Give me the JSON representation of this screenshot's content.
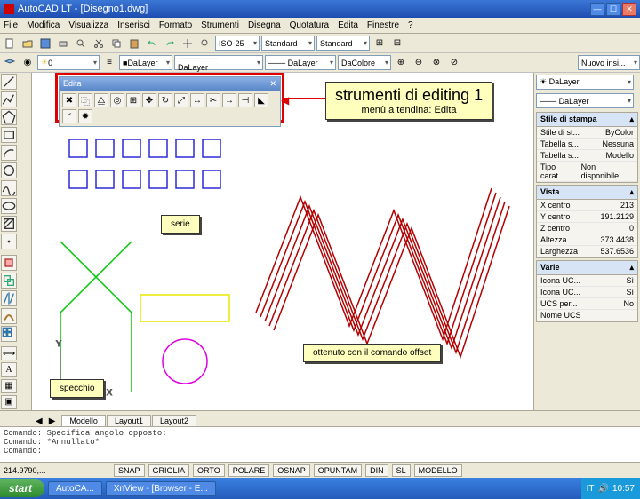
{
  "window": {
    "title": "AutoCAD LT - [Disegno1.dwg]",
    "close": "✕",
    "min": "—",
    "max": "☐"
  },
  "menus": [
    "File",
    "Modifica",
    "Visualizza",
    "Inserisci",
    "Formato",
    "Strumenti",
    "Disegna",
    "Quotatura",
    "Edita",
    "Finestre",
    "?"
  ],
  "selectors": {
    "layer": "0",
    "color": "DaLayer",
    "ltype": "─────── DaLayer",
    "lweight": "─── DaLayer",
    "scale": "ISO-25",
    "style": "Standard",
    "standard": "Standard",
    "altro": "DaColore",
    "nuovo": "Nuovo insi..."
  },
  "floatbar": {
    "title": "Edita",
    "close": "✕"
  },
  "annotations": {
    "title": "strumenti di editing 1",
    "subtitle": "menù a tendina: Edita",
    "serie": "serie",
    "specchio": "specchio",
    "offset": "ottenuto con il comando offset"
  },
  "rpanel": {
    "stile_hdr": "Stile di stampa",
    "stile_rows": [
      [
        "Stile di st...",
        "ByColor"
      ],
      [
        "Tabella s...",
        "Nessuna"
      ],
      [
        "Tabella s...",
        "Modello"
      ],
      [
        "Tipo carat...",
        "Non disponibile"
      ]
    ],
    "vista_hdr": "Vista",
    "vista_rows": [
      [
        "X centro",
        "213"
      ],
      [
        "Y centro",
        "191.2129"
      ],
      [
        "Z centro",
        "0"
      ],
      [
        "Altezza",
        "373.4438"
      ],
      [
        "Larghezza",
        "537.6536"
      ],
      [
        "",
        ""
      ]
    ],
    "varie_hdr": "Varie",
    "varie_rows": [
      [
        "Icona UC...",
        "Sì"
      ],
      [
        "Icona UC...",
        "Sì"
      ],
      [
        "UCS per...",
        "No"
      ],
      [
        "Nome UCS",
        ""
      ]
    ]
  },
  "tabs": [
    "Modello",
    "Layout1",
    "Layout2"
  ],
  "cmd": {
    "l1": "Comando: Specifica angolo opposto:",
    "l2": "Comando: *Annullato*",
    "prompt": "Comando:"
  },
  "status": {
    "coords": "214.9790,...",
    "btns": [
      "SNAP",
      "GRIGLIA",
      "ORTO",
      "POLARE",
      "OSNAP",
      "OPUNTAM",
      "DIN",
      "SL",
      "MODELLO"
    ]
  },
  "taskbar": {
    "start": "start",
    "items": [
      "AutoCA...",
      "",
      "XnView - [Browser - E..."
    ],
    "lang": "IT",
    "time": "10:57"
  }
}
